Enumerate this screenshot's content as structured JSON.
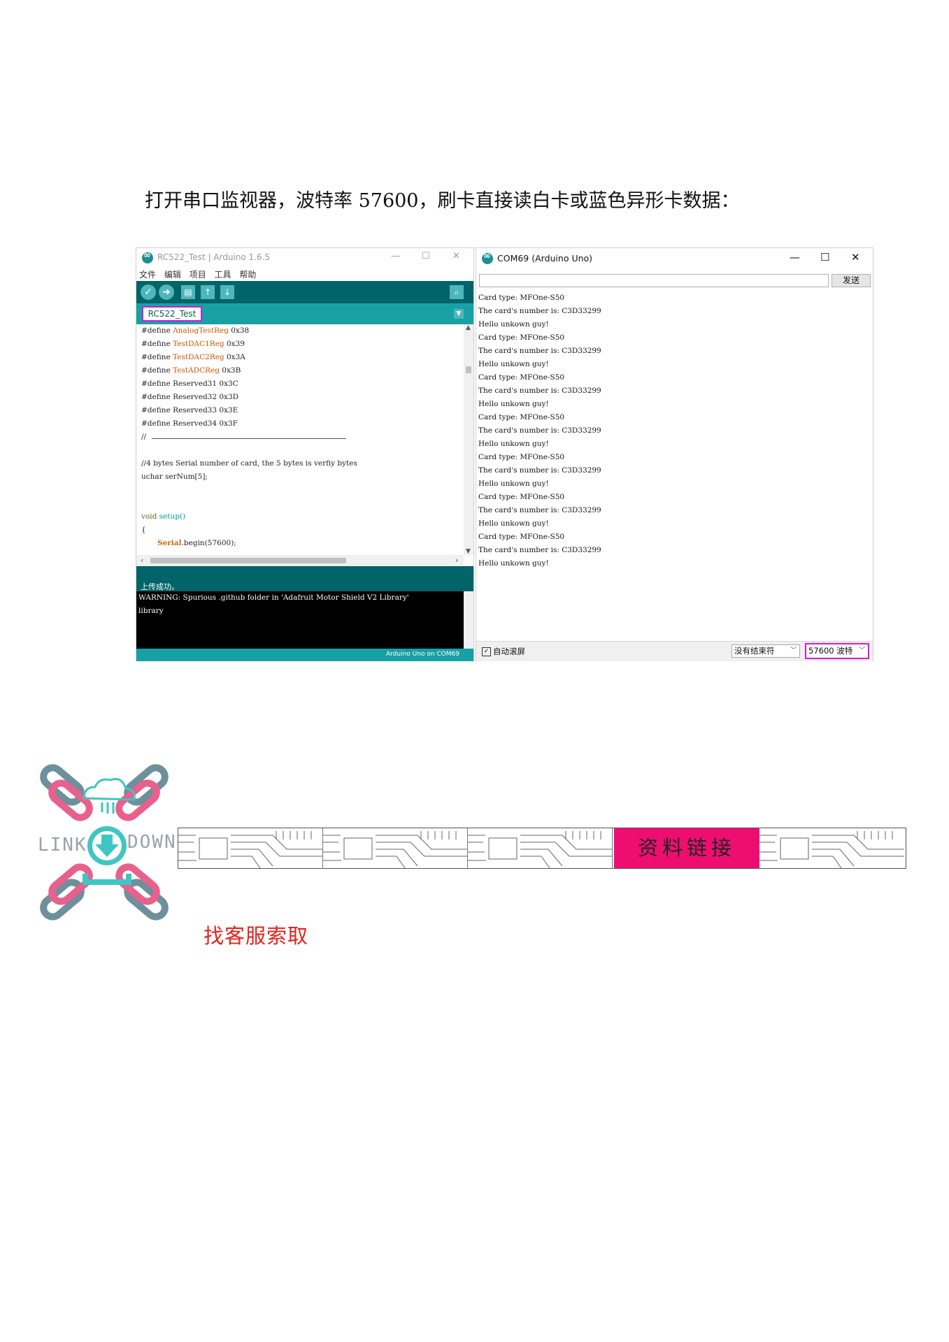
{
  "intro": "打开串口监视器，波特率 57600，刷卡直接读白卡或蓝色异形卡数据：",
  "ide": {
    "title": "RC522_Test | Arduino 1.6.5",
    "menu": [
      "文件",
      "编辑",
      "项目",
      "工具",
      "帮助"
    ],
    "tab": "RC522_Test",
    "code": [
      {
        "pre": "#define ",
        "name": "AnalogTestReg",
        "val": " 0x38"
      },
      {
        "pre": "#define ",
        "name": "TestDAC1Reg",
        "val": " 0x39"
      },
      {
        "pre": "#define ",
        "name": "TestDAC2Reg",
        "val": " 0x3A"
      },
      {
        "pre": "#define ",
        "name": "TestADCReg",
        "val": " 0x3B"
      },
      {
        "pre": "#define ",
        "name": "Reserved31",
        "val": " 0x3C"
      },
      {
        "pre": "#define ",
        "name": "Reserved32",
        "val": " 0x3D"
      },
      {
        "pre": "#define ",
        "name": "Reserved33",
        "val": " 0x3E"
      },
      {
        "pre": "#define ",
        "name": "Reserved34",
        "val": " 0x3F"
      }
    ],
    "rule_comment": "//",
    "comment": "//4 bytes Serial number of card, the 5 bytes is verfiy bytes",
    "decl": "uchar serNum[5];",
    "setup_kw": "void",
    "setup_fn": " setup()",
    "brace": "{",
    "serial_obj": "Serial",
    "serial_call": ".begin(57600);",
    "status": "上传成功。",
    "console": [
      "WARNING: Spurious .github folder in 'Adafruit Motor Shield V2 Library'",
      "library"
    ],
    "footer": "Arduino Uno on COM69"
  },
  "monitor": {
    "title": "COM69 (Arduino Uno)",
    "send": "发送",
    "output": [
      "Card type: MFOne-S50",
      "The card's number is: C3D33299",
      "Hello unkown guy!",
      "Card type: MFOne-S50",
      "The card's number is: C3D33299",
      "Hello unkown guy!",
      "Card type: MFOne-S50",
      "The card's number is: C3D33299",
      "Hello unkown guy!",
      "Card type: MFOne-S50",
      "The card's number is: C3D33299",
      "Hello unkown guy!",
      "Card type: MFOne-S50",
      "The card's number is: C3D33299",
      "Hello unkown guy!",
      "Card type: MFOne-S50",
      "The card's number is: C3D33299",
      "Hello unkown guy!",
      "Card type: MFOne-S50",
      "The card's number is: C3D33299",
      "Hello unkown guy!"
    ],
    "autoscroll": "自动滚屏",
    "line_ending": "没有结束符",
    "baud": "57600 波特"
  },
  "link": {
    "left_word": "LINK",
    "right_word": "DOWN",
    "banner_label": "资料链接",
    "contact": "找客服索取"
  },
  "colors": {
    "arduino_dark": "#006468",
    "arduino_teal": "#17a1a5",
    "highlight": "#d01bd4",
    "banner": "#ee0e71",
    "contact": "#e3221c"
  }
}
